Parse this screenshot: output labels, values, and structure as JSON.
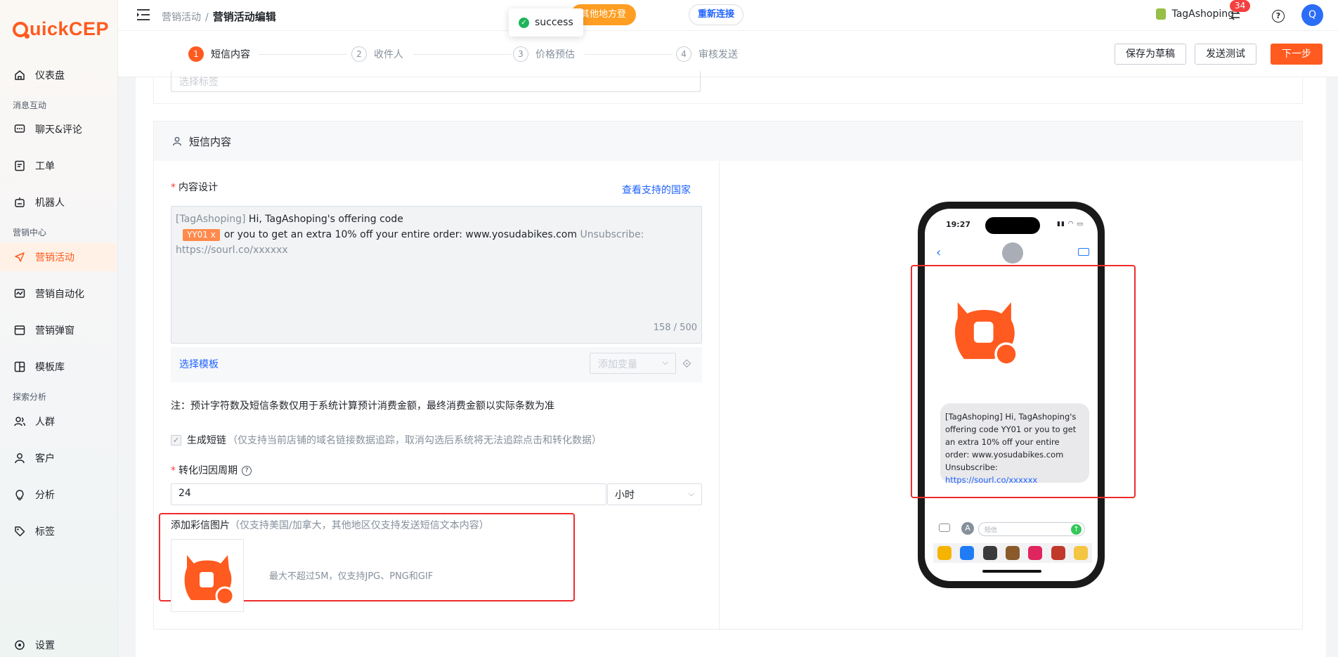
{
  "app": {
    "logo_text": "uickCEP",
    "brand_color": "#ff5a1f"
  },
  "sidebar": {
    "items": [
      {
        "label": "仪表盘",
        "icon": "home-icon"
      },
      {
        "group": "消息互动"
      },
      {
        "label": "聊天&评论",
        "icon": "chat-icon"
      },
      {
        "label": "工单",
        "icon": "ticket-icon"
      },
      {
        "label": "机器人",
        "icon": "robot-icon"
      },
      {
        "group": "营销中心"
      },
      {
        "label": "营销活动",
        "icon": "send-icon",
        "active": true
      },
      {
        "label": "营销自动化",
        "icon": "automation-icon"
      },
      {
        "label": "营销弹窗",
        "icon": "popup-icon"
      },
      {
        "label": "模板库",
        "icon": "template-icon"
      },
      {
        "group": "探索分析"
      },
      {
        "label": "人群",
        "icon": "people-icon"
      },
      {
        "label": "客户",
        "icon": "user-icon"
      },
      {
        "label": "分析",
        "icon": "bulb-icon"
      },
      {
        "label": "标签",
        "icon": "tag-icon"
      }
    ],
    "settings_label": "设置"
  },
  "header": {
    "breadcrumb_parent": "营销活动",
    "breadcrumb_sep": "/",
    "breadcrumb_current": "营销活动编辑",
    "other_login_text": "其他地方登",
    "reconnect_label": "重新连接",
    "toast_text": "success",
    "shop_name": "TagAshoping",
    "notification_count": "34",
    "avatar_letter": "Q"
  },
  "steps": [
    {
      "num": "1",
      "label": "短信内容",
      "active": true
    },
    {
      "num": "2",
      "label": "收件人"
    },
    {
      "num": "3",
      "label": "价格预估"
    },
    {
      "num": "4",
      "label": "审核发送"
    }
  ],
  "actions": {
    "save_draft": "保存为草稿",
    "send_test": "发送测试",
    "next": "下一步"
  },
  "form": {
    "tag_placeholder": "选择标签",
    "section_title": "短信内容",
    "content_label": "内容设计",
    "view_countries": "查看支持的国家",
    "editor_prefix": "[TagAshoping]",
    "editor_line1": " Hi, TagAshoping's offering code",
    "editor_chip": "YY01  x",
    "editor_line2": "or you to get an extra 10% off your entire order: www.yosudabikes.com",
    "editor_unsub": " Unsubscribe: https://sourl.co/xxxxxx",
    "counter": "158 / 500",
    "choose_template": "选择模板",
    "add_variable_placeholder": "添加变量",
    "note": "注：预计字符数及短信条数仅用于系统计算预计消费金额，最终消费金额以实际条数为准",
    "shortlink_label": "生成短链",
    "shortlink_hint": "（仅支持当前店铺的域名链接数据追踪，取消勾选后系统将无法追踪点击和转化数据）",
    "attribution_label": "转化归因周期",
    "attribution_value": "24",
    "attribution_unit": "小时",
    "mms_label": "添加彩信图片",
    "mms_hint": "（仅支持美国/加拿大，其他地区仅支持发送短信文本内容）",
    "upload_hint": "最大不超过5M，仅支持JPG、PNG和GIF"
  },
  "preview": {
    "time": "19:27",
    "message_prefix": "[TagAshoping]",
    "message_body": "  Hi, TagAshoping's offering code YY01 or you to get an extra 10% off your entire order: www.yosudabikes.com Unsubscribe: ",
    "message_url": "https://sourl.co/xxxxxx",
    "input_placeholder": "短信"
  },
  "colors": {
    "accent": "#ff5a1f",
    "link": "#1f63ff",
    "highlight_box": "#ef2b2b"
  }
}
